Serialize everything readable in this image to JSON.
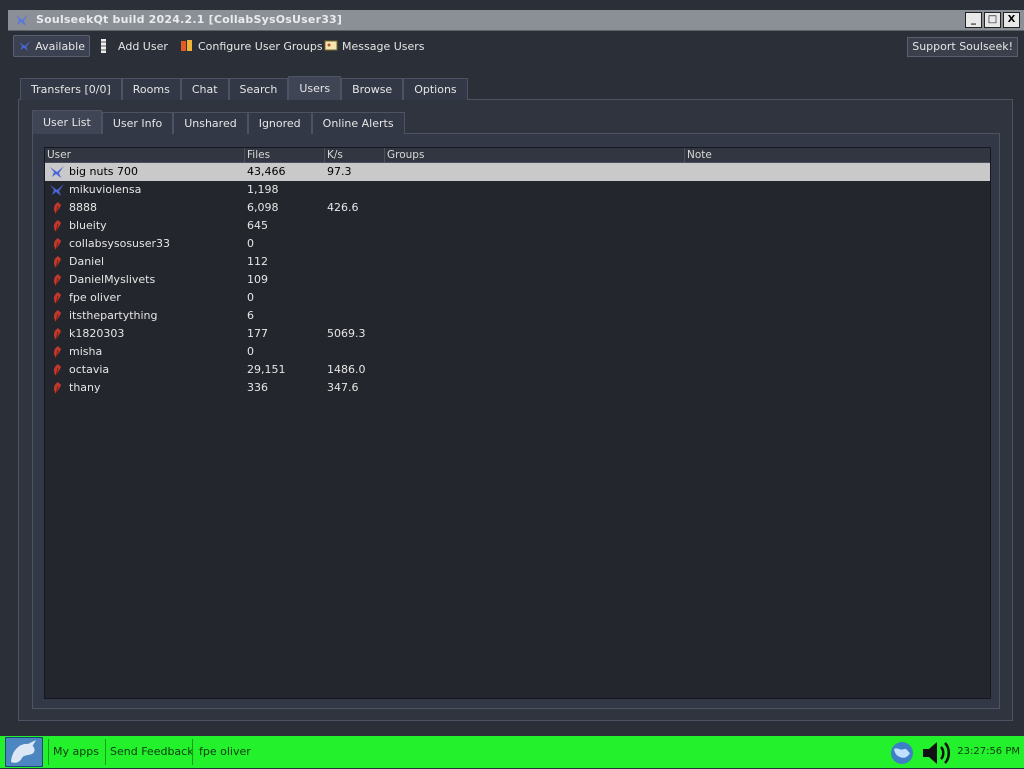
{
  "window": {
    "title": "SoulseekQt build 2024.2.1 [CollabSysOsUser33]",
    "controls": [
      "_",
      "□",
      "X"
    ]
  },
  "toolbar": {
    "available_label": "Available",
    "add_user_label": "Add User",
    "configure_groups_label": "Configure User Groups",
    "message_users_label": "Message Users",
    "support_label": "Support Soulseek!"
  },
  "tabs": [
    {
      "label": "Transfers [0/0]"
    },
    {
      "label": "Rooms"
    },
    {
      "label": "Chat"
    },
    {
      "label": "Search"
    },
    {
      "label": "Users",
      "active": true
    },
    {
      "label": "Browse"
    },
    {
      "label": "Options"
    }
  ],
  "subtabs": [
    {
      "label": "User List",
      "active": true
    },
    {
      "label": "User Info"
    },
    {
      "label": "Unshared"
    },
    {
      "label": "Ignored"
    },
    {
      "label": "Online Alerts"
    }
  ],
  "table": {
    "columns": [
      "User",
      "Files",
      "K/s",
      "Groups",
      "Note"
    ],
    "rows": [
      {
        "icon": "blue-bird-icon",
        "user": "big nuts 700",
        "files": "43,466",
        "speed": "97.3",
        "selected": true
      },
      {
        "icon": "blue-bird-icon",
        "user": "mikuviolensa",
        "files": "1,198",
        "speed": ""
      },
      {
        "icon": "red-feather-icon",
        "user": "8888",
        "files": "6,098",
        "speed": "426.6"
      },
      {
        "icon": "red-feather-icon",
        "user": "blueity",
        "files": "645",
        "speed": ""
      },
      {
        "icon": "red-feather-icon",
        "user": "collabsysosuser33",
        "files": "0",
        "speed": ""
      },
      {
        "icon": "red-feather-icon",
        "user": "Daniel",
        "files": "112",
        "speed": ""
      },
      {
        "icon": "red-feather-icon",
        "user": "DanielMyslivets",
        "files": "109",
        "speed": ""
      },
      {
        "icon": "red-feather-icon",
        "user": "fpe oliver",
        "files": "0",
        "speed": ""
      },
      {
        "icon": "red-feather-icon",
        "user": "itsthepartything",
        "files": "6",
        "speed": ""
      },
      {
        "icon": "red-feather-icon",
        "user": "k1820303",
        "files": "177",
        "speed": "5069.3"
      },
      {
        "icon": "red-feather-icon",
        "user": "misha",
        "files": "0",
        "speed": ""
      },
      {
        "icon": "red-feather-icon",
        "user": "octavia",
        "files": "29,151",
        "speed": "1486.0"
      },
      {
        "icon": "red-feather-icon",
        "user": "thany",
        "files": "336",
        "speed": "347.6"
      }
    ]
  },
  "taskbar": {
    "items": [
      "My apps",
      "Send Feedback",
      "fpe oliver"
    ],
    "clock": "23:27:56 PM"
  },
  "colors": {
    "window_bg": "#2b2f38",
    "taskbar": "#22f12b",
    "selected_row": "#c9c9c9",
    "bird_blue": "#4a66d8",
    "feather_red": "#c0392b"
  }
}
